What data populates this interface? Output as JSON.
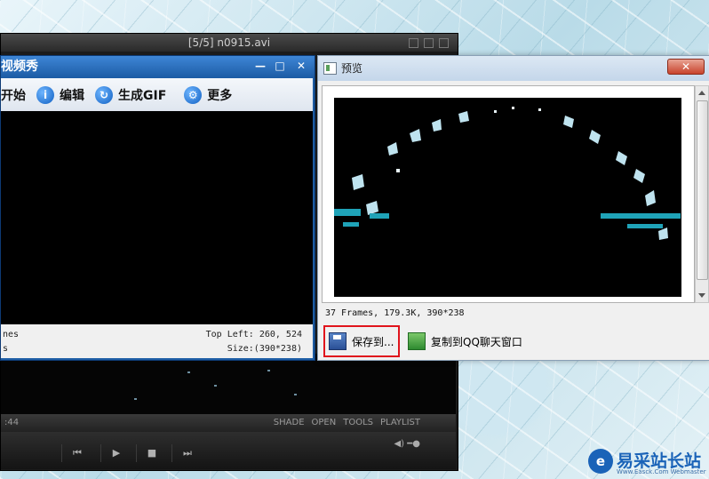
{
  "player": {
    "title": "[5/5] n0915.avi",
    "time": ":44",
    "menu": [
      "SHADE",
      "OPEN",
      "TOOLS",
      "PLAYLIST"
    ]
  },
  "app": {
    "title": "视频秀",
    "toolbar": [
      {
        "label": "开始",
        "icon": "play-icon"
      },
      {
        "label": "编辑",
        "icon": "info-icon"
      },
      {
        "label": "生成GIF",
        "icon": "refresh-icon"
      },
      {
        "label": "更多",
        "icon": "gear-icon"
      }
    ],
    "status": {
      "left1": "nes",
      "left2": "s",
      "top_left": "Top Left: 260, 524",
      "size": "Size:(390*238)"
    }
  },
  "dialog": {
    "title": "预览",
    "close": "✕",
    "info": "37 Frames, 179.3K, 390*238",
    "save_label": "保存到...",
    "copy_label": "复制到QQ聊天窗口"
  },
  "watermark": {
    "text": "易采站长站",
    "sub": "Www.Easck.Com Webmaster"
  }
}
